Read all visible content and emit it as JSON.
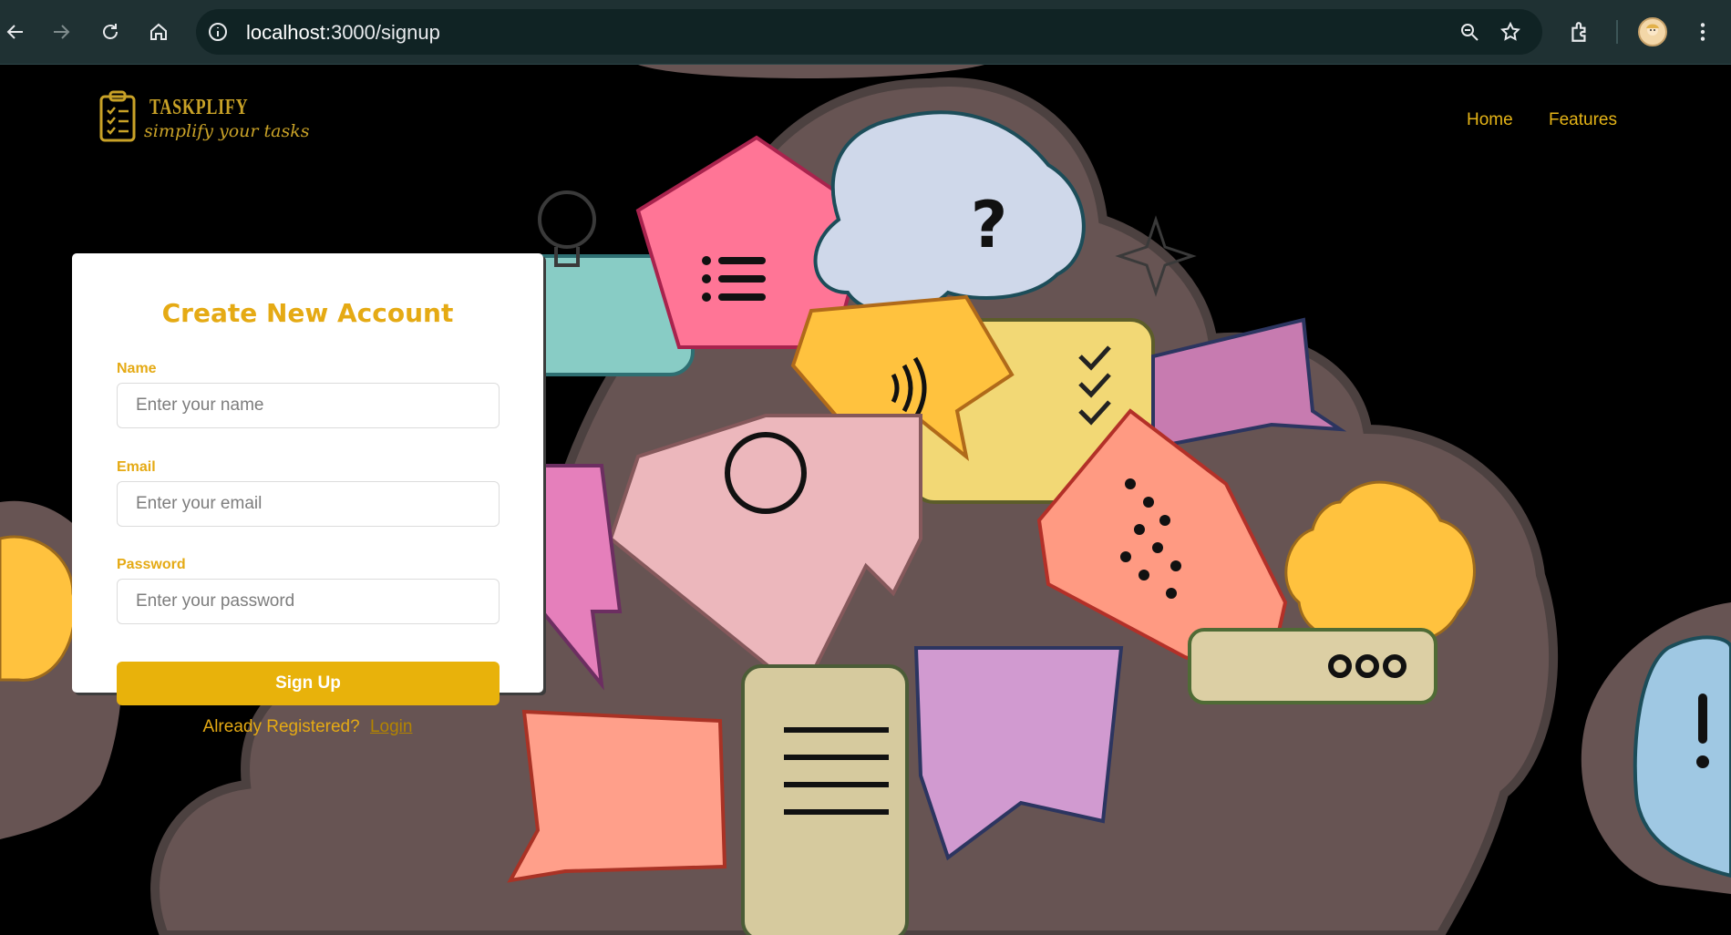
{
  "browser": {
    "url_host": "localhost",
    "url_path": ":3000/signup"
  },
  "brand": {
    "name": "TASKPLIFY",
    "tagline": "simplify your tasks"
  },
  "nav": {
    "items": [
      {
        "label": "Home"
      },
      {
        "label": "Features"
      }
    ]
  },
  "form": {
    "title": "Create New Account",
    "name_label": "Name",
    "name_placeholder": "Enter your name",
    "email_label": "Email",
    "email_placeholder": "Enter your email",
    "password_label": "Password",
    "password_placeholder": "Enter your password",
    "submit_label": "Sign Up",
    "already_text": "Already Registered?",
    "login_link": "Login"
  },
  "colors": {
    "accent": "#e5aa14",
    "button": "#e8b20b",
    "chrome": "#1f3133"
  }
}
